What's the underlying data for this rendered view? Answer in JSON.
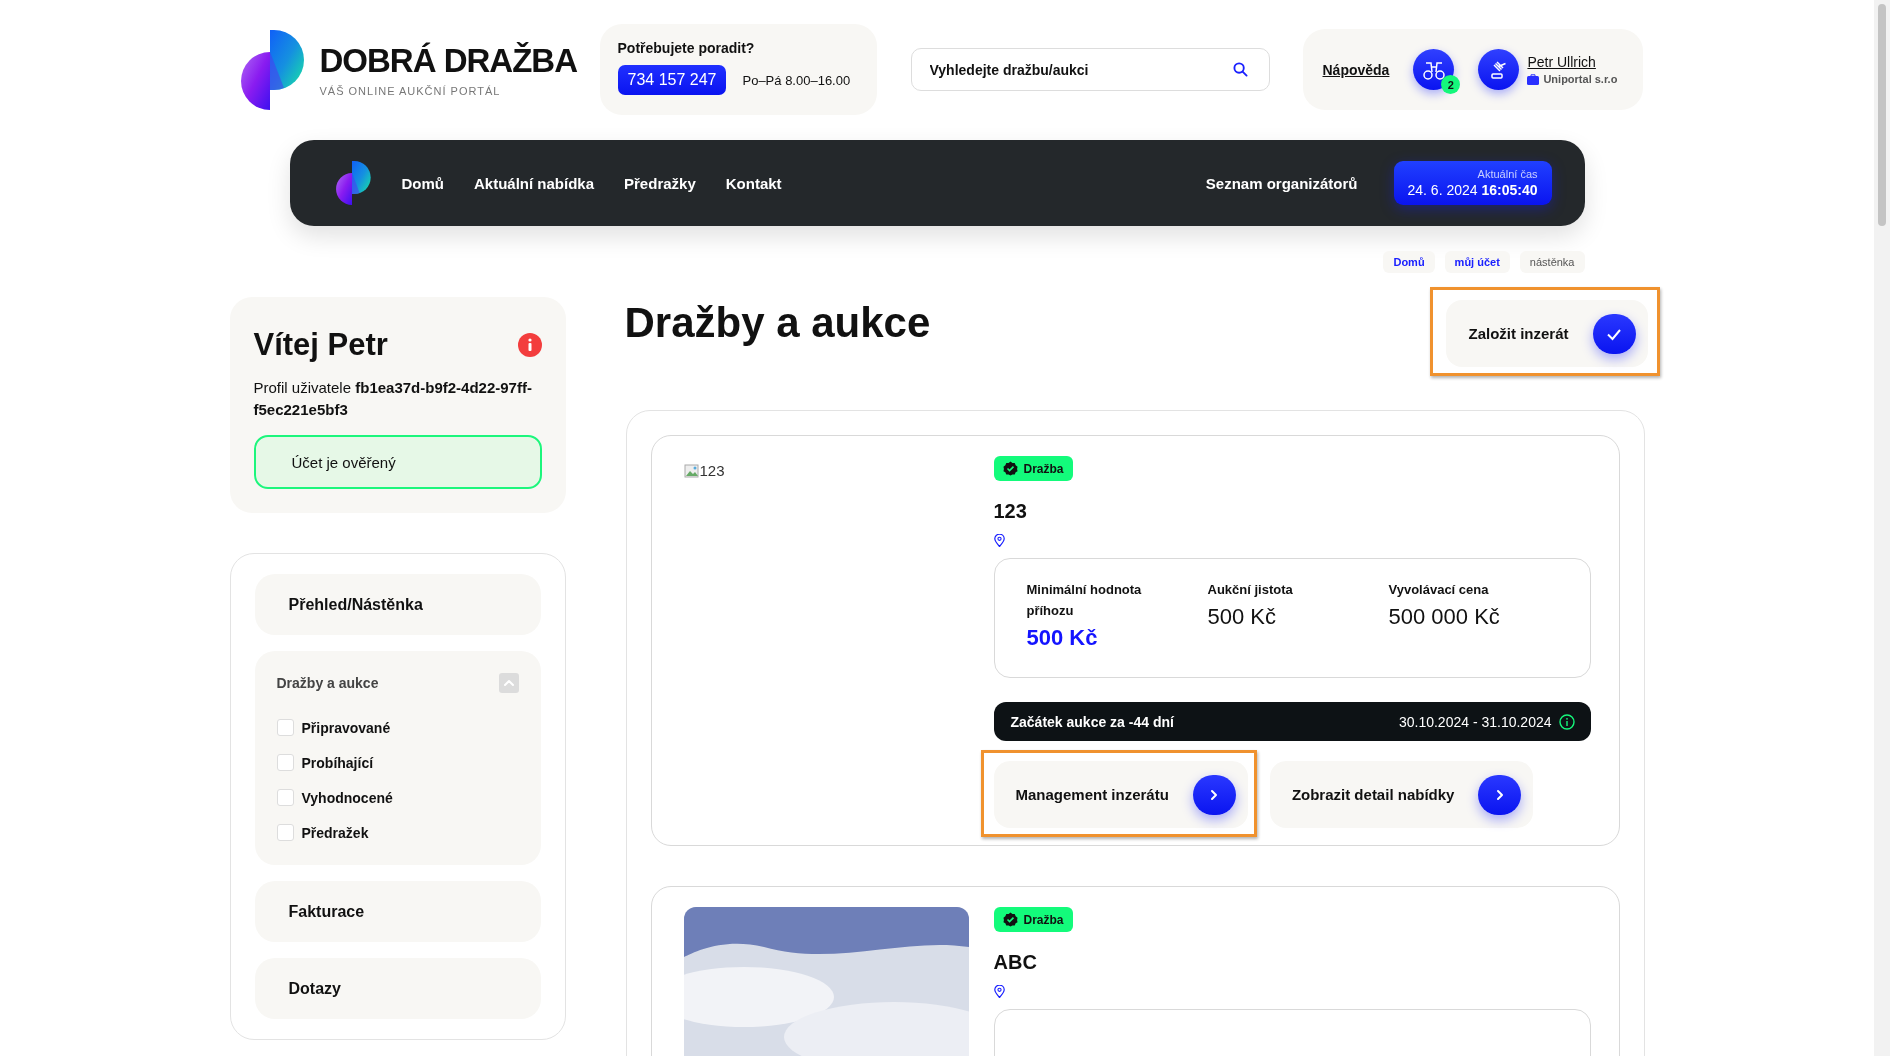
{
  "brand": {
    "name": "DOBRÁ DRAŽBA",
    "tagline": "VÁŠ ONLINE AUKČNÍ PORTÁL"
  },
  "help": {
    "title": "Potřebujete poradit?",
    "phone": "734 157 247",
    "hours": "Po–Pá 8.00–16.00"
  },
  "search": {
    "placeholder": "Vyhledejte dražbu/aukci"
  },
  "user_panel": {
    "help_link": "Nápověda",
    "watch_count": "2",
    "name": "Petr Ullrich",
    "company": "Uniportal s.r.o"
  },
  "nav": {
    "items": [
      {
        "label": "Domů"
      },
      {
        "label": "Aktuální nabídka"
      },
      {
        "label": "Předražky"
      },
      {
        "label": "Kontakt"
      }
    ],
    "right_link": "Seznam organizátorů",
    "clock": {
      "label": "Aktuální čas",
      "date": "24. 6. 2024",
      "time": "16:05:40"
    }
  },
  "breadcrumbs": [
    {
      "label": "Domů",
      "kind": "link"
    },
    {
      "label": "můj účet",
      "kind": "link"
    },
    {
      "label": "nástěnka",
      "kind": "current"
    }
  ],
  "welcome": {
    "title": "Vítej Petr",
    "profile_text": "Profil uživatele **fb1ea37d-b9f2-4d22-97ff-f5ec221e5bf3**",
    "verified": "Účet je ověřený"
  },
  "sidebar": {
    "items": [
      {
        "label": "Přehled/Nástěnka",
        "kind": "link"
      },
      {
        "label": "Dražby a aukce",
        "kind": "group",
        "expanded": true,
        "children": [
          {
            "label": "Připravované",
            "checked": false
          },
          {
            "label": "Probíhající",
            "checked": false
          },
          {
            "label": "Vyhodnocené",
            "checked": false
          },
          {
            "label": "Předražek",
            "checked": false
          }
        ]
      },
      {
        "label": "Fakturace",
        "kind": "link"
      },
      {
        "label": "Dotazy",
        "kind": "link"
      }
    ]
  },
  "page": {
    "title": "Dražby a aukce",
    "create_button": {
      "label": "Založit inzerát",
      "highlighted": true
    }
  },
  "listings": [
    {
      "image": {
        "kind": "broken",
        "alt": "123"
      },
      "badge": "Dražba",
      "title": "123",
      "stats": [
        {
          "label": "Minimální hodnota příhozu",
          "value": "500 Kč",
          "kind": "accent"
        },
        {
          "label": "Aukční jistota",
          "value": "500 Kč",
          "kind": "plain"
        },
        {
          "label": "Vyvolávací cena",
          "value": "500 000 Kč",
          "kind": "plain"
        }
      ],
      "countdown": "Začátek aukce za -44 dní",
      "dates": "30.10.2024 - 31.10.2024",
      "actions": [
        {
          "label": "Management inzerátu",
          "highlighted": true
        },
        {
          "label": "Zobrazit detail nabídky",
          "highlighted": false
        }
      ]
    },
    {
      "badge": "Dražba",
      "title": "ABC"
    }
  ]
}
